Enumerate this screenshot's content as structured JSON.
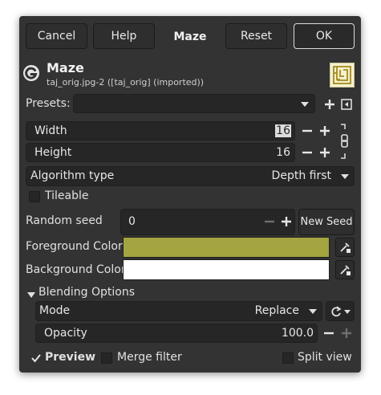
{
  "buttons": {
    "cancel": "Cancel",
    "help": "Help",
    "title": "Maze",
    "reset": "Reset",
    "ok": "OK"
  },
  "header": {
    "filter_name": "Maze",
    "source": "taj_orig.jpg-2 ([taj_orig] (imported))"
  },
  "presets": {
    "label": "Presets:",
    "value": ""
  },
  "size": {
    "width_label": "Width",
    "width_value": "16",
    "height_label": "Height",
    "height_value": "16"
  },
  "algorithm": {
    "label": "Algorithm type",
    "value": "Depth first"
  },
  "tileable": {
    "label": "Tileable",
    "checked": false
  },
  "random_seed": {
    "label": "Random seed",
    "value": "0",
    "new_seed_label": "New Seed"
  },
  "foreground": {
    "label": "Foreground Color",
    "color": "#a4a440"
  },
  "background": {
    "label": "Background Color",
    "color": "#ffffff"
  },
  "blending": {
    "section_label": "Blending Options",
    "mode_label": "Mode",
    "mode_value": "Replace",
    "opacity_label": "Opacity",
    "opacity_value": "100.0"
  },
  "footer": {
    "preview_label": "Preview",
    "preview_checked": true,
    "merge_label": "Merge filter",
    "merge_checked": false,
    "split_label": "Split view",
    "split_checked": false
  },
  "colors": {
    "dialog_bg": "#333333",
    "field_bg": "#262626",
    "foreground_swatch": "#a4a440",
    "background_swatch": "#ffffff"
  }
}
